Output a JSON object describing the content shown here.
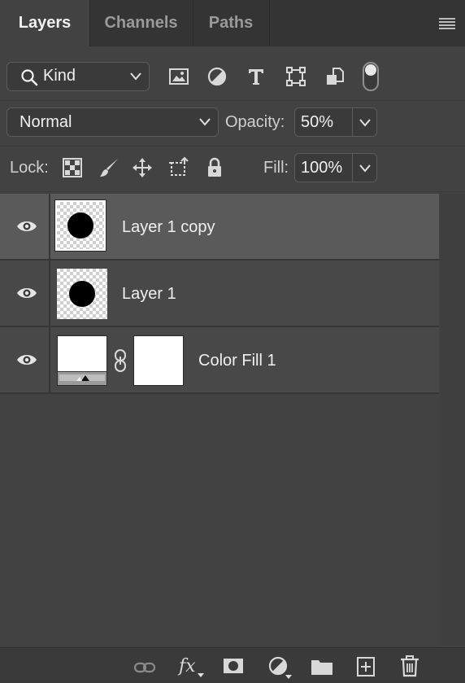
{
  "tabs": [
    {
      "label": "Layers",
      "active": true
    },
    {
      "label": "Channels",
      "active": false
    },
    {
      "label": "Paths",
      "active": false
    }
  ],
  "panel_menu_icon": "hamburger-icon",
  "filter": {
    "kind_label": "Kind",
    "icons": [
      "image-filter-icon",
      "adjustment-filter-icon",
      "type-filter-icon",
      "shape-filter-icon",
      "smart-object-filter-icon"
    ],
    "toggle_on": true
  },
  "blend": {
    "mode": "Normal",
    "opacity_label": "Opacity:",
    "opacity_value": "50%"
  },
  "lock": {
    "label": "Lock:",
    "icons": [
      "lock-transparent-pixels-icon",
      "lock-image-pixels-icon",
      "lock-position-icon",
      "lock-artboard-icon",
      "lock-all-icon"
    ],
    "fill_label": "Fill:",
    "fill_value": "100%"
  },
  "layers": [
    {
      "name": "Layer 1 copy",
      "visible": true,
      "selected": true,
      "type": "pixel"
    },
    {
      "name": "Layer 1",
      "visible": true,
      "selected": false,
      "type": "pixel"
    },
    {
      "name": "Color Fill 1",
      "visible": true,
      "selected": false,
      "type": "fill",
      "fill_color": "#ffffff"
    }
  ],
  "bottom_icons": [
    "link-layers-icon",
    "fx-icon",
    "add-mask-icon",
    "adjustment-layer-icon",
    "new-group-icon",
    "new-layer-icon",
    "delete-icon"
  ],
  "bottom_fx_label": "fx",
  "colors": {
    "panel_bg": "#424242",
    "tab_bar": "#343434",
    "selected_row": "#5a5a5a",
    "row_bg": "#484848",
    "text": "#f0f0f0"
  }
}
